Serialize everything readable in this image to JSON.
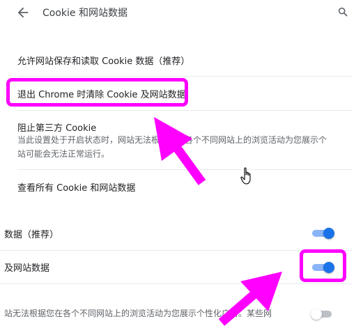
{
  "header": {
    "title": "Cookie 和网站数据",
    "back_icon": "arrow-left-icon",
    "search_icon": "search-icon"
  },
  "settings": {
    "allow_sites": "允许网站保存和读取 Cookie 数据（推荐）",
    "clear_on_exit": "退出 Chrome 时清除 Cookie 及网站数据",
    "block_third_party_title": "阻止第三方 Cookie",
    "block_third_party_desc_1": "当此设置处于开启状态时，网站无法根据您在各个不同网站上的浏览活动为您展示个",
    "block_third_party_desc_2": "站可能会无法正常运行。",
    "view_all": "查看所有 Cookie 和网站数据"
  },
  "lower": {
    "row1_label": "数据（推荐）",
    "row1_state": "on",
    "row2_label": "及网站数据",
    "row2_state": "on",
    "row3_label": "站无法根据您在各个不同网站上的浏览活动为您展示个性化广告。某些网",
    "row3_state": "off"
  },
  "colors": {
    "annotation": "#ff00ff",
    "toggle_on": "#1a73e8",
    "toggle_on_track": "#8ab4f8"
  }
}
